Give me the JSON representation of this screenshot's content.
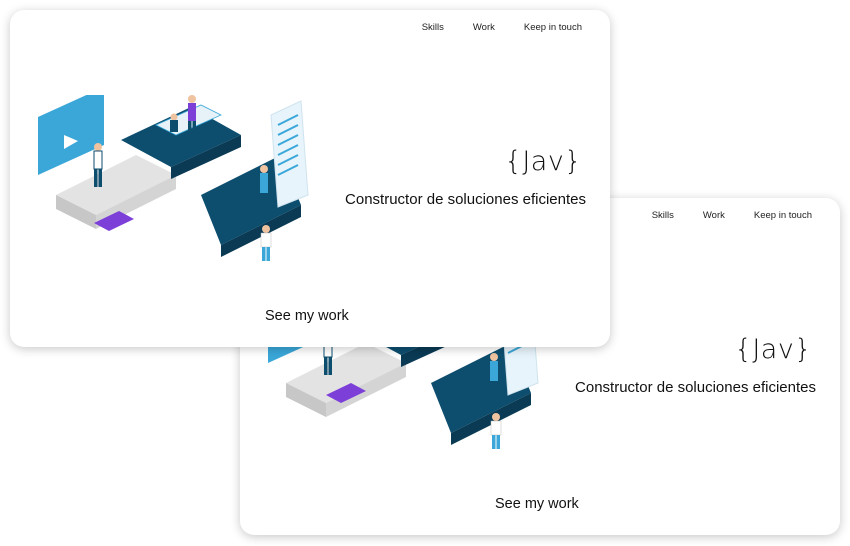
{
  "nav": {
    "skills": "Skills",
    "work": "Work",
    "contact": "Keep in touch"
  },
  "hero": {
    "code": "{Jav}",
    "tagline": "Constructor de soluciones eficientes"
  },
  "cta": {
    "label": "See my work"
  },
  "illustration": {
    "name": "puzzle-teamwork-illustration"
  },
  "colors": {
    "puzzle_dark": "#0d4e6f",
    "puzzle_light": "#e3e3e3",
    "accent_blue": "#3aa7d8",
    "accent_purple": "#7c3fd8"
  }
}
